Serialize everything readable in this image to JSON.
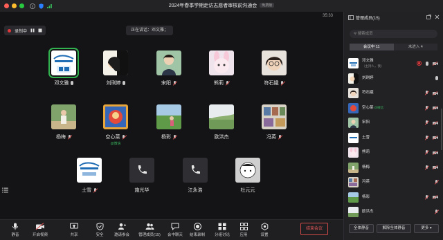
{
  "window": {
    "title": "2024年春季学期走访志愿者审核前沟通会",
    "badge": "免费版"
  },
  "recording": {
    "label": "录制中"
  },
  "speaking": {
    "text": "正在讲话：邓文雅；"
  },
  "timer": "35:33",
  "participants_grid": [
    {
      "name": "邓文雅",
      "mic": "on",
      "sub": ""
    },
    {
      "name": "刘琍婷",
      "mic": "on",
      "sub": ""
    },
    {
      "name": "宋阳",
      "mic": "muted",
      "sub": ""
    },
    {
      "name": "熊莉",
      "mic": "muted",
      "sub": ""
    },
    {
      "name": "符石娥",
      "mic": "muted",
      "sub": ""
    },
    {
      "name": "杨梅",
      "mic": "muted",
      "sub": ""
    },
    {
      "name": "空心菜",
      "mic": "muted",
      "sub": "@微信"
    },
    {
      "name": "杨彩",
      "mic": "muted",
      "sub": ""
    },
    {
      "name": "欧洪杰",
      "mic": "",
      "sub": ""
    },
    {
      "name": "冯英",
      "mic": "muted",
      "sub": ""
    },
    {
      "name": "土雪",
      "mic": "muted",
      "sub": ""
    },
    {
      "name": "施光华",
      "mic": "",
      "sub": ""
    },
    {
      "name": "江永浩",
      "mic": "",
      "sub": ""
    },
    {
      "name": "杜元元",
      "mic": "",
      "sub": ""
    }
  ],
  "toolbar": {
    "items": [
      "静音",
      "开启视频",
      "共享",
      "安全",
      "邀请参会",
      "管理成员(15)",
      "会中聊天",
      "结束录制",
      "分组讨论",
      "应用",
      "设置"
    ],
    "end": "结束会议"
  },
  "sidebar": {
    "title": "管理成员(15)",
    "search_placeholder": "搜索成员",
    "tabs": [
      "会议中 11",
      "未进入 4"
    ],
    "members": [
      {
        "name": "邓文雅",
        "note": "（主持人，我）"
      },
      {
        "name": "刘琍婷",
        "note": ""
      },
      {
        "name": "符石娥",
        "note": ""
      },
      {
        "name": "空心菜",
        "note": "@微信"
      },
      {
        "name": "宋阳",
        "note": ""
      },
      {
        "name": "土雪",
        "note": ""
      },
      {
        "name": "熊莉",
        "note": ""
      },
      {
        "name": "杨梅",
        "note": ""
      },
      {
        "name": "冯英",
        "note": ""
      },
      {
        "name": "杨彩",
        "note": ""
      },
      {
        "name": "欧洪杰",
        "note": ""
      }
    ],
    "footer": {
      "mute_all": "全体静音",
      "unmute_all": "解除全体静音",
      "more": "更多"
    }
  },
  "colors": {
    "accent": "#2b7fff",
    "record": "#e0383b",
    "end": "#e45757",
    "speaking_border": "#32b24e",
    "wechat": "#38b15c"
  }
}
